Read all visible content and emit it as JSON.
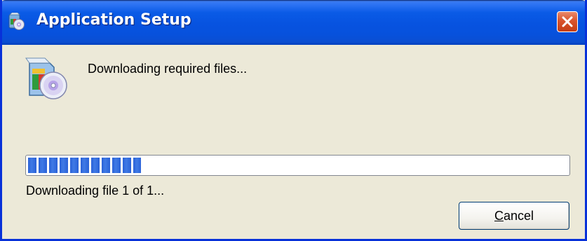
{
  "window": {
    "title": "Application Setup",
    "title_icon": "setup-installer-icon",
    "close_icon": "close-icon",
    "accent_color": "#0831d9",
    "close_color": "#d9542d"
  },
  "content": {
    "icon": "setup-installer-icon",
    "message": "Downloading required files...",
    "progress": {
      "fraction": 0.21,
      "fill_color": "#2a61d6"
    },
    "status": "Downloading file 1 of 1..."
  },
  "buttons": {
    "cancel": {
      "mnemonic": "C",
      "rest": "ancel"
    }
  }
}
